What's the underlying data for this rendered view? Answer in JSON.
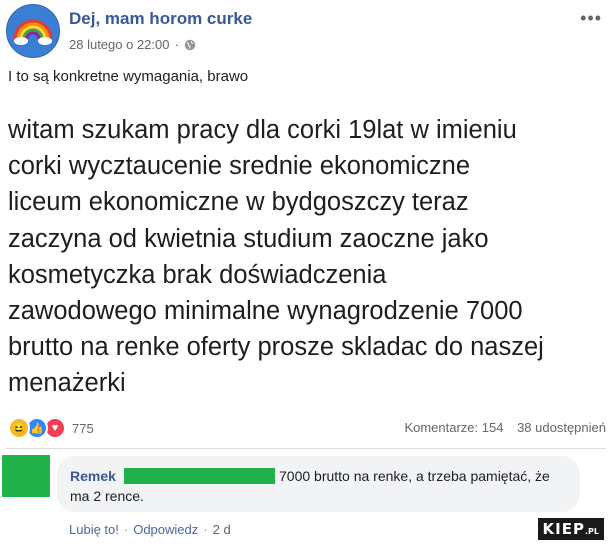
{
  "post": {
    "page_name": "Dej, mam horom curke",
    "timestamp": "28 lutego o 22:00",
    "privacy_icon": "globe-icon",
    "caption": "I to są konkretne wymagania, brawo",
    "body_lines": [
      "witam szukam pracy dla corki 19lat w imieniu",
      "corki wycztaucenie srednie ekonomiczne",
      "liceum ekonomiczne w bydgoszczy teraz",
      "zaczyna od kwietnia studium zaoczne jako",
      "kosmetyczka brak doświadczenia",
      "zawodowego minimalne wynagrodzenie 7000",
      "brutto na renke oferty prosze skladac do naszej",
      "menażerki"
    ]
  },
  "reactions": {
    "icons": [
      "haha-icon",
      "like-icon",
      "love-icon"
    ],
    "count": "775",
    "comments": "Komentarze: 154",
    "shares": "38 udostępnień"
  },
  "comment": {
    "author": "Remek",
    "text_line1": "7000 brutto na renke, a trzeba pamiętać, że",
    "text_line2": "ma 2 rence.",
    "like_label": "Lubię to!",
    "reply_label": "Odpowiedz",
    "age": "2 d"
  },
  "watermark": {
    "main": "KIEP",
    "suffix": ".PL"
  },
  "colors": {
    "link": "#385898",
    "redaction": "#22b24c",
    "avatar": "#3b7fd4"
  }
}
